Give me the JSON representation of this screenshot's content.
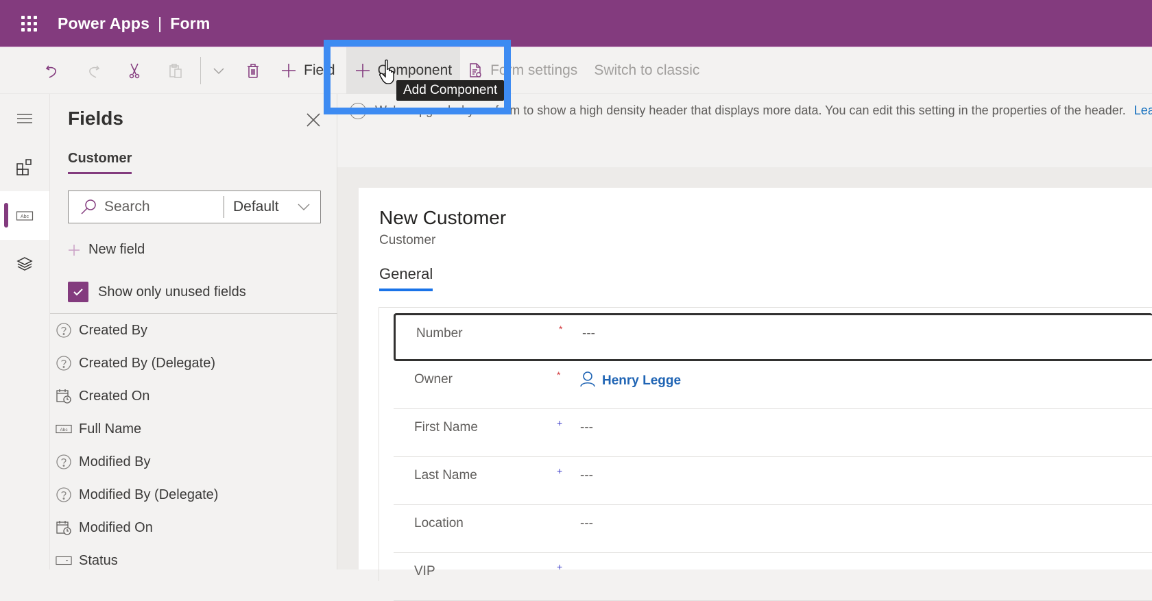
{
  "header": {
    "app_name": "Power Apps",
    "separator": "|",
    "page_name": "Form",
    "brand_color": "#833b7e"
  },
  "toolbar": {
    "undo_label": "Undo",
    "redo_label": "Redo",
    "cut_label": "Cut",
    "paste_label": "Paste",
    "more_label": "More",
    "delete_label": "Delete",
    "field_label": "Field",
    "component_label": "Component",
    "form_settings_label": "Form settings",
    "switch_classic_label": "Switch to classic",
    "tooltip": "Add Component"
  },
  "leftnav": {
    "items": [
      {
        "name": "menu",
        "icon": "hamburger-icon"
      },
      {
        "name": "components",
        "icon": "components-icon"
      },
      {
        "name": "fields",
        "icon": "text-field-icon",
        "active": true
      },
      {
        "name": "tree-view",
        "icon": "layers-icon"
      }
    ]
  },
  "fields_panel": {
    "title": "Fields",
    "tab": "Customer",
    "search_placeholder": "Search",
    "filter_value": "Default",
    "new_field_label": "New field",
    "show_unused_label": "Show only unused fields",
    "show_unused_checked": true,
    "items": [
      {
        "label": "Created By",
        "icon": "question-circle-icon"
      },
      {
        "label": "Created By (Delegate)",
        "icon": "question-circle-icon"
      },
      {
        "label": "Created On",
        "icon": "calendar-clock-icon"
      },
      {
        "label": "Full Name",
        "icon": "text-field-icon"
      },
      {
        "label": "Modified By",
        "icon": "question-circle-icon"
      },
      {
        "label": "Modified By (Delegate)",
        "icon": "question-circle-icon"
      },
      {
        "label": "Modified On",
        "icon": "calendar-clock-icon"
      },
      {
        "label": "Status",
        "icon": "dropdown-field-icon"
      }
    ]
  },
  "notice": {
    "text": "We've upgraded your form to show a high density header that displays more data. You can edit this setting in the properties of the header.",
    "link": "Lea"
  },
  "form": {
    "title": "New Customer",
    "subtitle": "Customer",
    "tab": "General",
    "fields": [
      {
        "label": "Number",
        "required": "*",
        "req_type": "required",
        "value": "---"
      },
      {
        "label": "Owner",
        "required": "*",
        "req_type": "required",
        "value": "Henry Legge",
        "lookup": true
      },
      {
        "label": "First Name",
        "required": "+",
        "req_type": "recommended",
        "value": "---"
      },
      {
        "label": "Last Name",
        "required": "+",
        "req_type": "recommended",
        "value": "---"
      },
      {
        "label": "Location",
        "required": "",
        "req_type": "none",
        "value": "---"
      },
      {
        "label": "VIP",
        "required": "+",
        "req_type": "recommended",
        "value": ""
      }
    ]
  }
}
